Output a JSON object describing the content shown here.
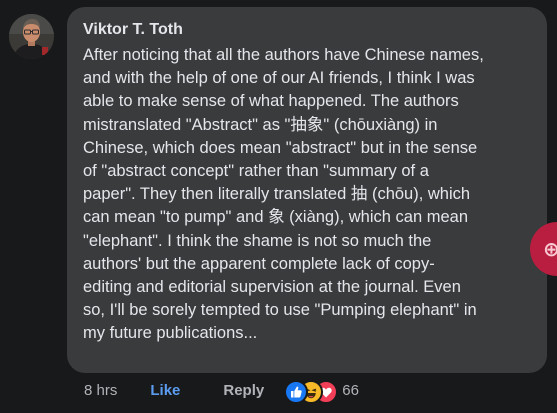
{
  "comment": {
    "author": "Viktor T. Toth",
    "text": "After noticing that all the authors have Chinese names,\nand with the help of one of our AI friends, I think I was\nable to make sense of what happened. The authors\nmistranslated \"Abstract\" as \"抽象\" (chōuxiàng) in\nChinese, which does mean \"abstract\" but in the sense\nof \"abstract concept\" rather than \"summary of a\npaper\". They then literally translated 抽 (chōu), which\ncan mean \"to pump\" and 象 (xiàng), which can mean\n\"elephant\". I think the shame is not so much the\nauthors' but the apparent complete lack of copy-\nediting and editorial supervision at the journal. Even\nso, I'll be sorely tempted to use \"Pumping elephant\" in\nmy future publications...",
    "avatar_icon": "user-avatar"
  },
  "actions": {
    "time": "8 hrs",
    "like_label": "Like",
    "reply_label": "Reply",
    "reaction_icons": [
      "like-reaction-icon",
      "haha-reaction-icon",
      "love-reaction-icon"
    ],
    "reaction_count": "66"
  },
  "side_button": {
    "icon": "add-reaction-icon"
  },
  "colors": {
    "background": "#18191a",
    "bubble": "#3a3b3c",
    "text": "#e4e6eb",
    "muted": "#b0b3b8",
    "like_blue": "#5b9cf0",
    "side_button": "#b91d3f"
  }
}
